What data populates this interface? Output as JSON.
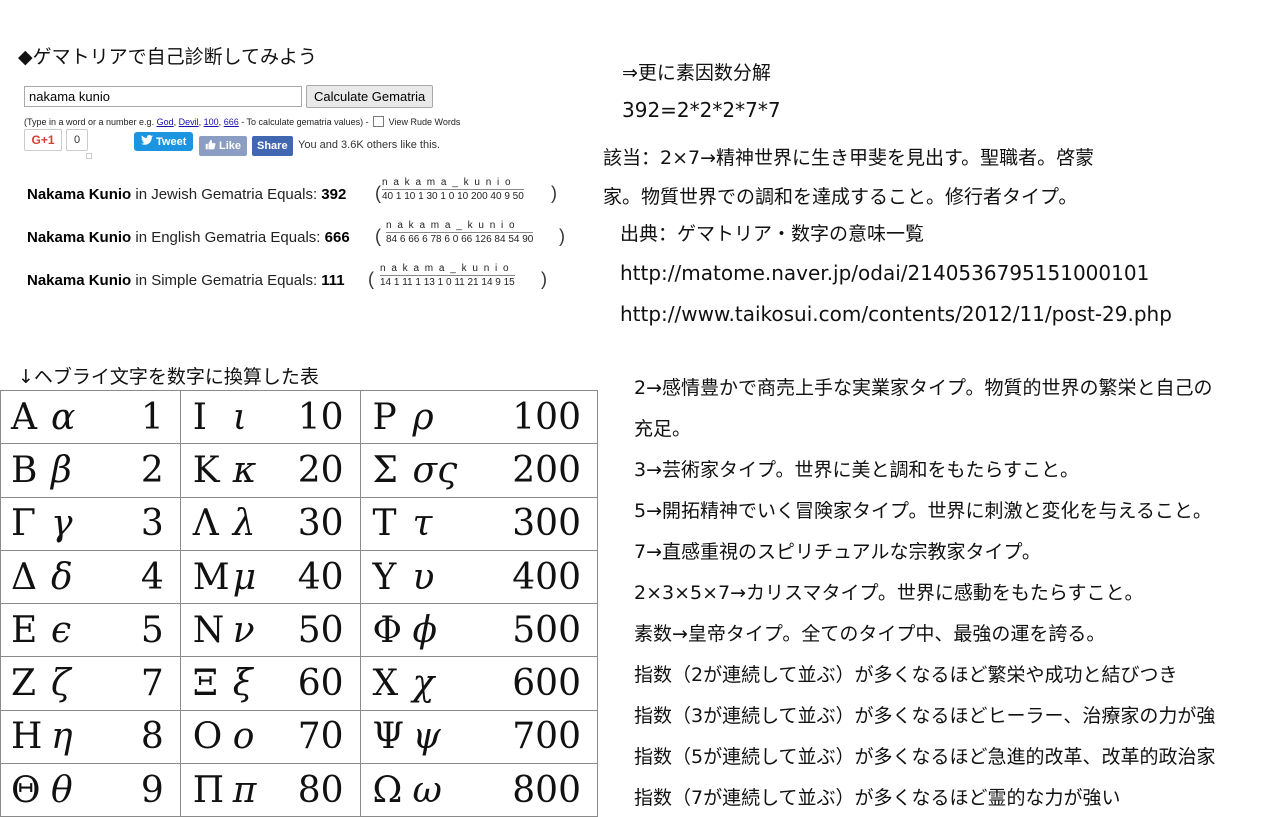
{
  "gematria": {
    "heading": "◆ゲマトリアで自己診断してみよう",
    "input_value": "nakama kunio",
    "calc_button": "Calculate Gematria",
    "hint_prefix": "(Type in a word or a number e.g. ",
    "hint_god": "God",
    "hint_devil": "Devil",
    "hint_100": "100",
    "hint_666": "666",
    "hint_sep": ", ",
    "hint_suffix": " - To calculate gematria values) - ",
    "rude_label": "View Rude Words",
    "gplus_label": "G+1",
    "gplus_count": "0",
    "tweet_label": "Tweet",
    "like_label": "Like",
    "share_label": "Share",
    "fb_text": "You and 3.6K others like this.",
    "results": [
      {
        "name": "Nakama Kunio",
        "system_text": " in Jewish Gematria Equals: ",
        "value": "392",
        "letters": "n a k a m a _ k u n i o",
        "numbers": "40 1 10 1 30 1 0 10 200 40 9 50"
      },
      {
        "name": "Nakama Kunio",
        "system_text": " in English Gematria Equals: ",
        "value": "666",
        "letters": "n a k a m a _ k u n i o",
        "numbers": "84 6 66 6 78 6 0 66 126 84 54 90"
      },
      {
        "name": "Nakama Kunio",
        "system_text": " in Simple Gematria Equals: ",
        "value": "111",
        "letters": "n a k a m a _ k u n i o",
        "numbers": "14 1 11 1 13 1 0 11 21 14 9 15"
      }
    ]
  },
  "table": {
    "heading": "↓ヘブライ文字を数字に換算した表",
    "rows": [
      [
        {
          "u": "Α",
          "l": "α",
          "n": "1"
        },
        {
          "u": "Ι",
          "l": "ι",
          "n": "10"
        },
        {
          "u": "Ρ",
          "l": "ρ",
          "n": "100"
        }
      ],
      [
        {
          "u": "Β",
          "l": "β",
          "n": "2"
        },
        {
          "u": "Κ",
          "l": "κ",
          "n": "20"
        },
        {
          "u": "Σ",
          "l": "σς",
          "n": "200"
        }
      ],
      [
        {
          "u": "Γ",
          "l": "γ",
          "n": "3"
        },
        {
          "u": "Λ",
          "l": "λ",
          "n": "30"
        },
        {
          "u": "Τ",
          "l": "τ",
          "n": "300"
        }
      ],
      [
        {
          "u": "Δ",
          "l": "δ",
          "n": "4"
        },
        {
          "u": "Μ",
          "l": "μ",
          "n": "40"
        },
        {
          "u": "Υ",
          "l": "υ",
          "n": "400"
        }
      ],
      [
        {
          "u": "Ε",
          "l": "ϵ",
          "n": "5"
        },
        {
          "u": "Ν",
          "l": "ν",
          "n": "50"
        },
        {
          "u": "Φ",
          "l": "ϕ",
          "n": "500"
        }
      ],
      [
        {
          "u": "Ζ",
          "l": "ζ",
          "n": "7"
        },
        {
          "u": "Ξ",
          "l": "ξ",
          "n": "60"
        },
        {
          "u": "Χ",
          "l": "χ",
          "n": "600"
        }
      ],
      [
        {
          "u": "Η",
          "l": "η",
          "n": "8"
        },
        {
          "u": "Ο",
          "l": "ο",
          "n": "70"
        },
        {
          "u": "Ψ",
          "l": "ψ",
          "n": "700"
        }
      ],
      [
        {
          "u": "Θ",
          "l": "θ",
          "n": "9"
        },
        {
          "u": "Π",
          "l": "π",
          "n": "80"
        },
        {
          "u": "Ω",
          "l": "ω",
          "n": "800"
        }
      ]
    ]
  },
  "analysis": {
    "line1": "⇒更に素因数分解",
    "line2": "392=2*2*2*7*7",
    "line3": "該当：2×7→精神世界に生き甲斐を見出す。聖職者。啓蒙",
    "line4": "家。物質世界での調和を達成すること。修行者タイプ。",
    "source": "出典：ゲマトリア・数字の意味一覧",
    "url1": "http://matome.naver.jp/odai/2140536795151000101",
    "url2": "http://www.taikosui.com/contents/2012/11/post-29.php"
  },
  "meanings": [
    "2→感情豊かで商売上手な実業家タイプ。物質的世界の繁栄と自己の",
    "充足。",
    "3→芸術家タイプ。世界に美と調和をもたらすこと。",
    "5→開拓精神でいく冒険家タイプ。世界に刺激と変化を与えること。",
    "7→直感重視のスピリチュアルな宗教家タイプ。",
    "2×3×5×7→カリスマタイプ。世界に感動をもたらすこと。",
    "素数→皇帝タイプ。全てのタイプ中、最強の運を誇る。",
    "指数（2が連続して並ぶ）が多くなるほど繁栄や成功と結びつき",
    "指数（3が連続して並ぶ）が多くなるほどヒーラー、治療家の力が強",
    "指数（5が連続して並ぶ）が多くなるほど急進的改革、改革的政治家",
    "指数（7が連続して並ぶ）が多くなるほど霊的な力が強い"
  ]
}
